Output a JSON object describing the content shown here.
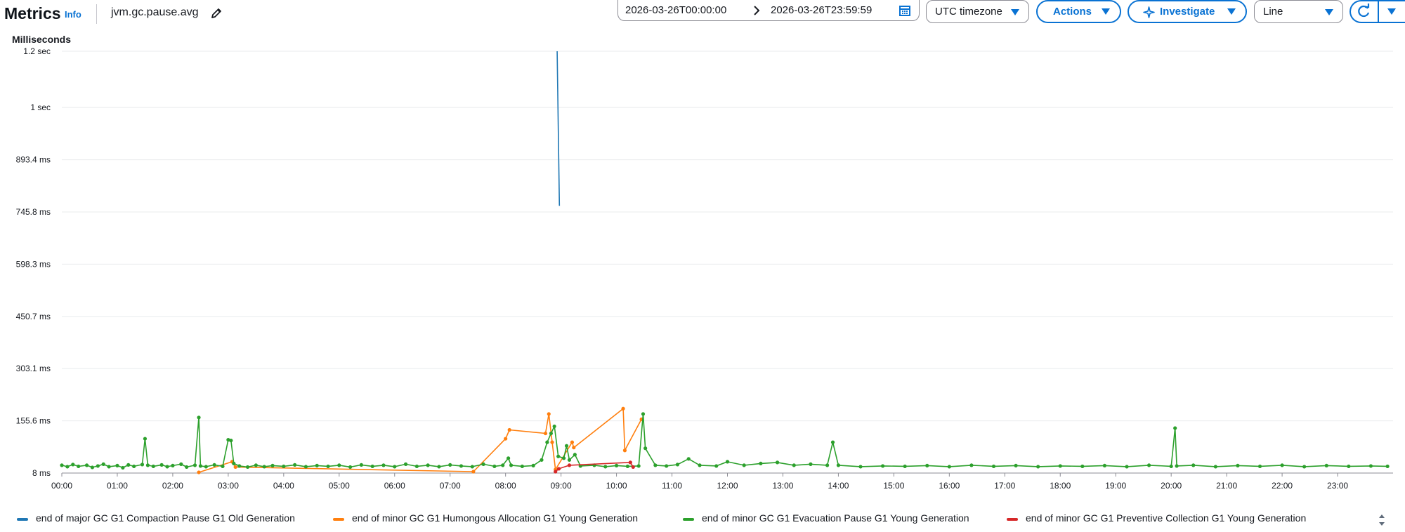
{
  "header": {
    "title": "Metrics",
    "info_label": "Info",
    "metric_name": "jvm.gc.pause.avg"
  },
  "toolbar": {
    "date_start": "2026-03-26T00:00:00",
    "date_end": "2026-03-26T23:59:59",
    "timezone": "UTC timezone",
    "actions_label": "Actions",
    "investigate_label": "Investigate",
    "view_type": "Line"
  },
  "colors": {
    "accent": "#0972d3",
    "major_gc_compaction": "#1f77b4",
    "minor_gc_humongous": "#ff7f0e",
    "minor_gc_evacuation": "#2ca02c",
    "minor_gc_preventive": "#d62728"
  },
  "icons": {
    "edit": "pencil-icon",
    "date_separator": "chevron-right-icon",
    "calendar": "calendar-icon",
    "investigate": "sparkle-icon",
    "refresh": "refresh-icon",
    "dropdown": "caret-down-icon"
  },
  "chart_data": {
    "type": "line",
    "ylabel": "Milliseconds",
    "y_ticks": [
      "1.2 sec",
      "1 sec",
      "893.4 ms",
      "745.8 ms",
      "598.3 ms",
      "450.7 ms",
      "303.1 ms",
      "155.6 ms",
      "8 ms"
    ],
    "y_tick_values_ms": [
      1200,
      1041,
      893.4,
      745.8,
      598.3,
      450.7,
      303.1,
      155.6,
      8
    ],
    "ylim": [
      8,
      1200
    ],
    "x_ticks": [
      "00:00",
      "01:00",
      "02:00",
      "03:00",
      "04:00",
      "05:00",
      "06:00",
      "07:00",
      "08:00",
      "09:00",
      "10:00",
      "11:00",
      "12:00",
      "13:00",
      "14:00",
      "15:00",
      "16:00",
      "17:00",
      "18:00",
      "19:00",
      "20:00",
      "21:00",
      "22:00",
      "23:00"
    ],
    "x_range_hours": [
      0,
      24
    ],
    "grid": true,
    "legend_position": "bottom",
    "series": [
      {
        "name": "end of major GC G1 Compaction Pause G1 Old Generation",
        "color": "#1f77b4",
        "points": [
          [
            8.93,
            1200
          ],
          [
            8.97,
            763
          ]
        ]
      },
      {
        "name": "end of minor GC G1 Humongous Allocation G1 Young Generation",
        "color": "#ff7f0e",
        "points": [
          [
            2.47,
            10
          ],
          [
            3.07,
            40
          ],
          [
            3.13,
            25
          ],
          [
            7.42,
            12
          ],
          [
            8.0,
            105
          ],
          [
            8.07,
            130
          ],
          [
            8.72,
            120
          ],
          [
            8.78,
            175
          ],
          [
            8.84,
            95
          ],
          [
            8.9,
            18
          ],
          [
            9.2,
            95
          ],
          [
            9.23,
            80
          ],
          [
            10.12,
            190
          ],
          [
            10.15,
            72
          ],
          [
            10.45,
            160
          ]
        ]
      },
      {
        "name": "end of minor GC G1 Evacuation Pause G1 Young Generation",
        "color": "#2ca02c",
        "points": [
          [
            0.0,
            30
          ],
          [
            0.1,
            26
          ],
          [
            0.2,
            32
          ],
          [
            0.3,
            27
          ],
          [
            0.45,
            30
          ],
          [
            0.55,
            24
          ],
          [
            0.65,
            28
          ],
          [
            0.75,
            33
          ],
          [
            0.85,
            26
          ],
          [
            1.0,
            29
          ],
          [
            1.1,
            23
          ],
          [
            1.2,
            31
          ],
          [
            1.3,
            27
          ],
          [
            1.45,
            32
          ],
          [
            1.5,
            105
          ],
          [
            1.55,
            30
          ],
          [
            1.65,
            27
          ],
          [
            1.8,
            31
          ],
          [
            1.9,
            26
          ],
          [
            2.0,
            29
          ],
          [
            2.15,
            33
          ],
          [
            2.25,
            25
          ],
          [
            2.4,
            30
          ],
          [
            2.47,
            165
          ],
          [
            2.5,
            28
          ],
          [
            2.6,
            26
          ],
          [
            2.75,
            31
          ],
          [
            2.9,
            27
          ],
          [
            3.0,
            102
          ],
          [
            3.05,
            100
          ],
          [
            3.1,
            35
          ],
          [
            3.2,
            28
          ],
          [
            3.35,
            25
          ],
          [
            3.5,
            30
          ],
          [
            3.65,
            26
          ],
          [
            3.8,
            29
          ],
          [
            4.0,
            27
          ],
          [
            4.2,
            31
          ],
          [
            4.4,
            26
          ],
          [
            4.6,
            29
          ],
          [
            4.8,
            27
          ],
          [
            5.0,
            30
          ],
          [
            5.2,
            25
          ],
          [
            5.4,
            31
          ],
          [
            5.6,
            27
          ],
          [
            5.8,
            30
          ],
          [
            6.0,
            26
          ],
          [
            6.2,
            33
          ],
          [
            6.4,
            27
          ],
          [
            6.6,
            30
          ],
          [
            6.8,
            26
          ],
          [
            7.0,
            31
          ],
          [
            7.2,
            28
          ],
          [
            7.4,
            26
          ],
          [
            7.6,
            33
          ],
          [
            7.8,
            27
          ],
          [
            7.95,
            30
          ],
          [
            8.05,
            50
          ],
          [
            8.1,
            30
          ],
          [
            8.3,
            27
          ],
          [
            8.5,
            29
          ],
          [
            8.65,
            45
          ],
          [
            8.75,
            95
          ],
          [
            8.82,
            120
          ],
          [
            8.88,
            140
          ],
          [
            8.95,
            55
          ],
          [
            9.05,
            50
          ],
          [
            9.1,
            85
          ],
          [
            9.15,
            45
          ],
          [
            9.25,
            60
          ],
          [
            9.35,
            28
          ],
          [
            9.6,
            30
          ],
          [
            9.8,
            26
          ],
          [
            10.0,
            29
          ],
          [
            10.2,
            27
          ],
          [
            10.4,
            28
          ],
          [
            10.48,
            175
          ],
          [
            10.52,
            78
          ],
          [
            10.7,
            30
          ],
          [
            10.9,
            28
          ],
          [
            11.1,
            32
          ],
          [
            11.3,
            48
          ],
          [
            11.5,
            30
          ],
          [
            11.8,
            28
          ],
          [
            12.0,
            40
          ],
          [
            12.3,
            30
          ],
          [
            12.6,
            35
          ],
          [
            12.9,
            38
          ],
          [
            13.2,
            30
          ],
          [
            13.5,
            33
          ],
          [
            13.8,
            30
          ],
          [
            13.9,
            95
          ],
          [
            14.0,
            30
          ],
          [
            14.4,
            26
          ],
          [
            14.8,
            28
          ],
          [
            15.2,
            27
          ],
          [
            15.6,
            29
          ],
          [
            16.0,
            26
          ],
          [
            16.4,
            30
          ],
          [
            16.8,
            27
          ],
          [
            17.2,
            29
          ],
          [
            17.6,
            26
          ],
          [
            18.0,
            28
          ],
          [
            18.4,
            27
          ],
          [
            18.8,
            29
          ],
          [
            19.2,
            26
          ],
          [
            19.6,
            30
          ],
          [
            20.0,
            27
          ],
          [
            20.07,
            135
          ],
          [
            20.1,
            28
          ],
          [
            20.4,
            30
          ],
          [
            20.8,
            26
          ],
          [
            21.2,
            29
          ],
          [
            21.6,
            27
          ],
          [
            22.0,
            30
          ],
          [
            22.4,
            26
          ],
          [
            22.8,
            29
          ],
          [
            23.2,
            27
          ],
          [
            23.6,
            28
          ],
          [
            23.9,
            27
          ]
        ]
      },
      {
        "name": "end of minor GC G1 Preventive Collection G1 Young Generation",
        "color": "#d62728",
        "points": [
          [
            8.9,
            12
          ],
          [
            8.96,
            20
          ],
          [
            9.15,
            30
          ],
          [
            10.25,
            38
          ],
          [
            10.3,
            25
          ]
        ]
      }
    ]
  }
}
